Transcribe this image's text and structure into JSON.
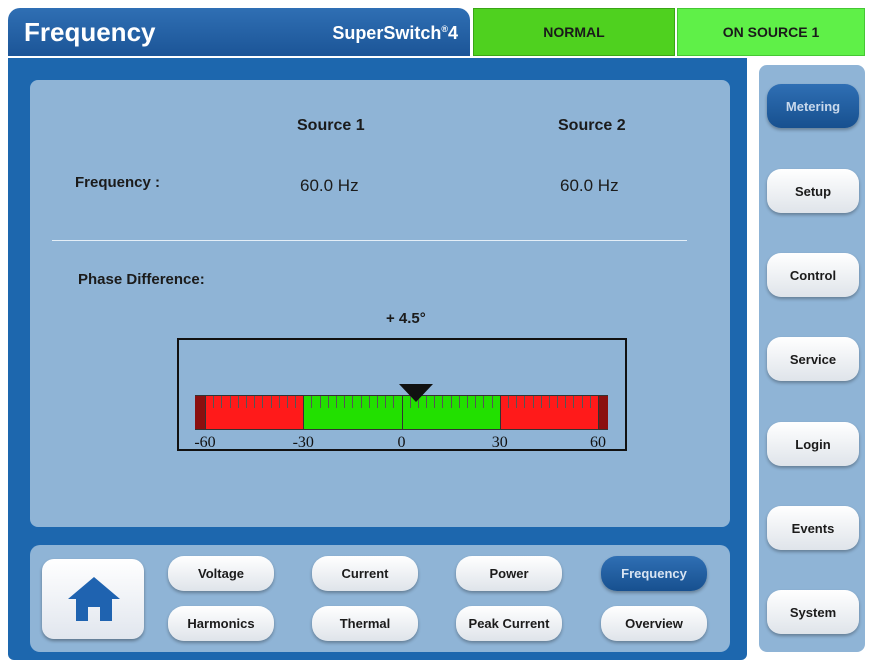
{
  "header": {
    "title": "Frequency",
    "brand": "SuperSwitch",
    "brand_sup": "®",
    "brand_num": "4"
  },
  "status": {
    "mode": "NORMAL",
    "source": "ON SOURCE 1"
  },
  "metering": {
    "source1_label": "Source 1",
    "source2_label": "Source 2",
    "frequency_label": "Frequency :",
    "source1_frequency": "60.0 Hz",
    "source2_frequency": "60.0 Hz",
    "phase_label": "Phase Difference:",
    "phase_value_text": "+ 4.5°",
    "phase_value": 4.5,
    "gauge": {
      "min": -60,
      "max": 60,
      "scale_labels": [
        "-60",
        "-30",
        "0",
        "30",
        "60"
      ],
      "ok_range": [
        -30,
        30
      ],
      "colors": {
        "ok": "#22e000",
        "bad": "#ff1a1a",
        "end": "#8b0f0f"
      }
    }
  },
  "bottom_nav": {
    "home_icon": "home-icon",
    "row1": [
      "Voltage",
      "Current",
      "Power",
      "Frequency"
    ],
    "row2": [
      "Harmonics",
      "Thermal",
      "Peak Current",
      "Overview"
    ],
    "active": "Frequency"
  },
  "side_nav": {
    "items": [
      "Metering",
      "Setup",
      "Control",
      "Service",
      "Login",
      "Events",
      "System"
    ],
    "active": "Metering"
  }
}
